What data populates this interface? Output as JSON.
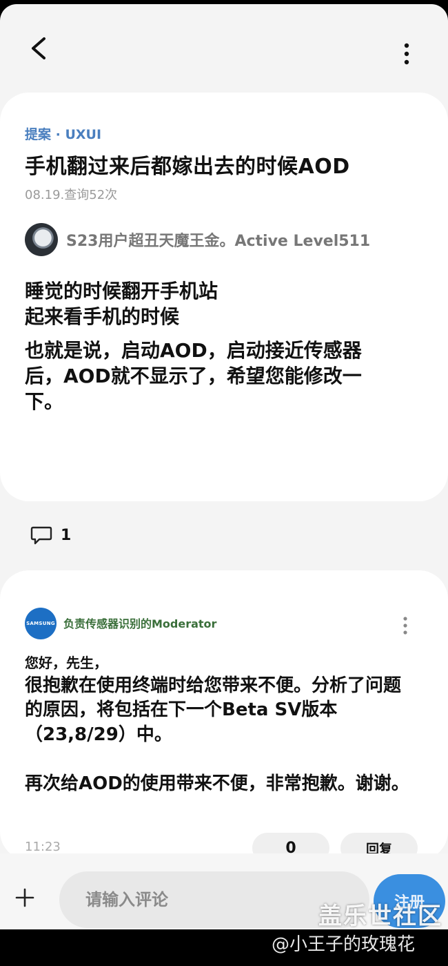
{
  "post": {
    "category": "提案 · UXUI",
    "title": "手机翻过来后都嫁出去的时候AOD",
    "meta": "08.19.查询52次",
    "author": "S23用户超丑天魔王金。Active Level511",
    "body": [
      "睡觉的时候翻开手机站",
      "起来看手机的时候",
      "也就是说，启动AOD，启动接近传感器后，AOD就不显示了，希望您能修改一下。"
    ]
  },
  "comments": {
    "count": "1"
  },
  "reply": {
    "logo_text": "SAMSUNG",
    "author": "负责传感器识别的Moderator",
    "greeting": "您好，先生，",
    "paragraphs": [
      "很抱歉在使用终端时给您带来不便。分析了问题的原因，将包括在下一个Beta SV版本（23,8/29）中。",
      "再次给AOD的使用带来不便，非常抱歉。谢谢。"
    ],
    "time": "11:23",
    "likes": "0",
    "reply_label": "回复"
  },
  "composer": {
    "placeholder": "请输入评论",
    "submit_label": "注册"
  },
  "watermark": {
    "site": "盖乐世社区",
    "user": "@小王子的玫瑰花"
  },
  "colors": {
    "accent": "#4a7fbf",
    "submit": "#3a8fe0",
    "moderator": "#3a6f3a"
  }
}
